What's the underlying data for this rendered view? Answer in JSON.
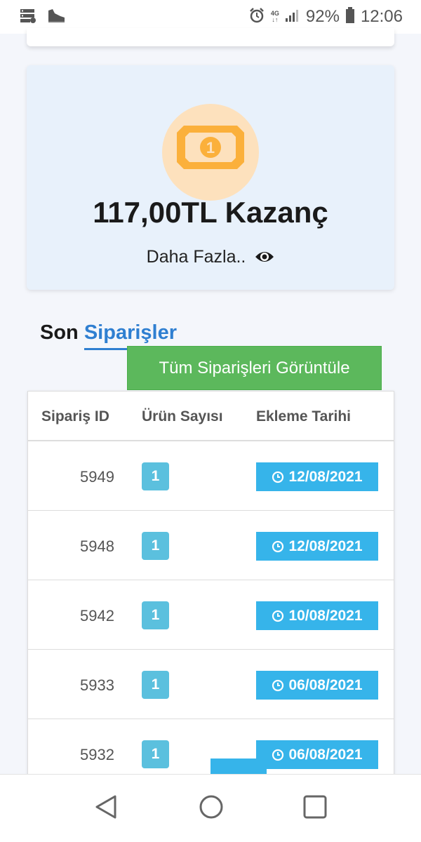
{
  "status_bar": {
    "battery_percent": "92%",
    "time": "12:06",
    "network_label": "4G"
  },
  "earnings": {
    "title": "117,00TL Kazanç",
    "more_label": "Daha Fazla..",
    "icon": "money-bill-icon",
    "icon_digit": "1"
  },
  "recent_orders": {
    "title_prefix": "Son",
    "title_accent": "Siparişler",
    "view_all_label": "Tüm Siparişleri Görüntüle",
    "columns": [
      "Sipariş ID",
      "Ürün Sayısı",
      "Ekleme Tarihi"
    ],
    "rows": [
      {
        "id": "5949",
        "qty": "1",
        "date": "12/08/2021"
      },
      {
        "id": "5948",
        "qty": "1",
        "date": "12/08/2021"
      },
      {
        "id": "5942",
        "qty": "1",
        "date": "10/08/2021"
      },
      {
        "id": "5933",
        "qty": "1",
        "date": "06/08/2021"
      },
      {
        "id": "5932",
        "qty": "1",
        "date": "06/08/2021"
      }
    ]
  },
  "colors": {
    "accent_blue": "#2f7fd1",
    "success_green": "#5cb85c",
    "info_badge": "#5bc0de",
    "date_badge": "#36b4ea",
    "coin_orange": "#fbb03b"
  }
}
